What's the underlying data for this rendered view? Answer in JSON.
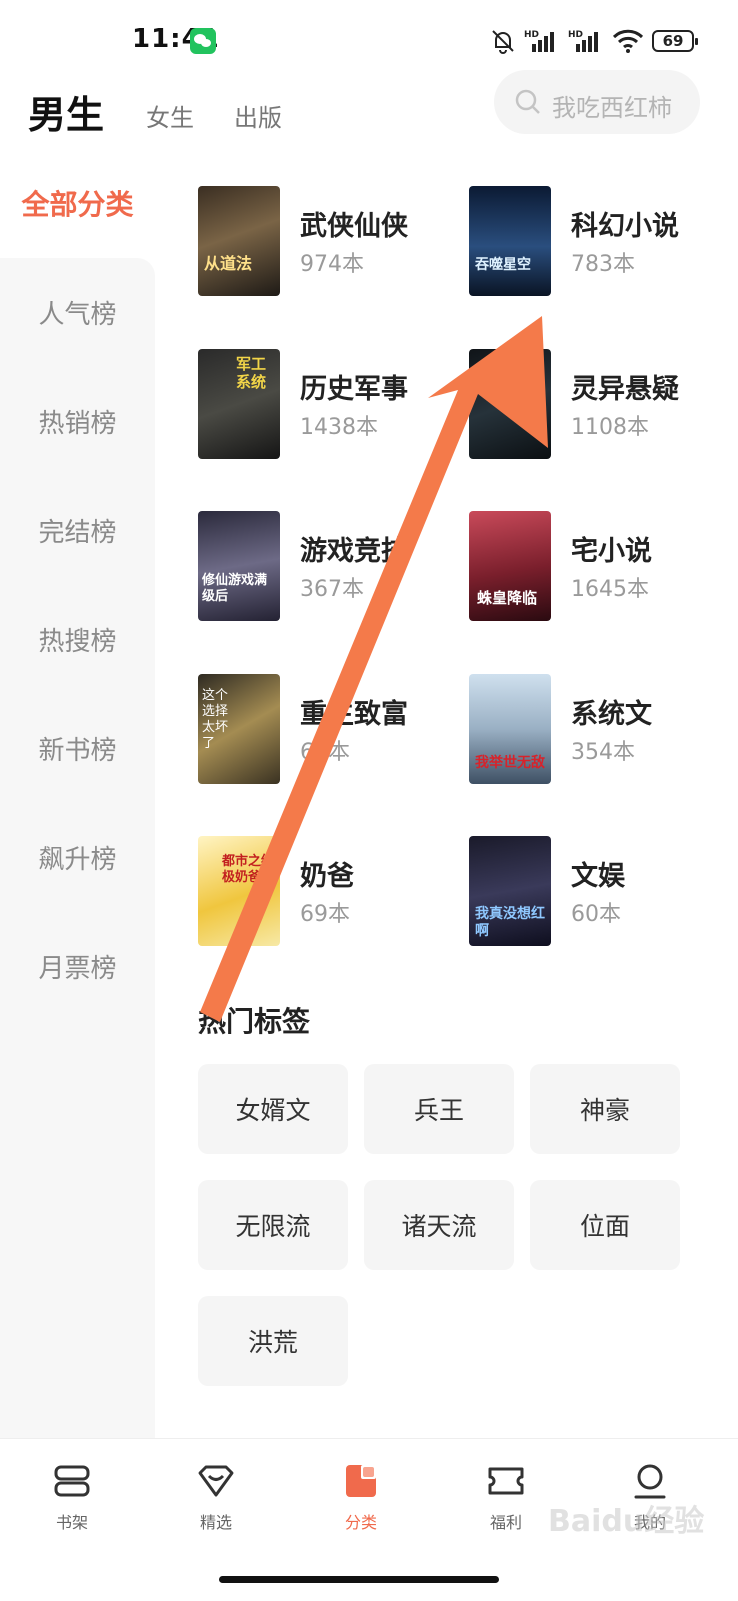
{
  "status_bar": {
    "time": "11:41",
    "battery": "69",
    "signal_tag": "HD"
  },
  "top_nav": {
    "tabs": [
      "男生",
      "女生",
      "出版"
    ],
    "search_placeholder": "我吃西红柿"
  },
  "sidebar": {
    "active": "全部分类",
    "items": [
      "人气榜",
      "热销榜",
      "完结榜",
      "热搜榜",
      "新书榜",
      "飙升榜",
      "月票榜"
    ]
  },
  "categories": [
    {
      "name": "武侠仙侠",
      "count": "974本",
      "cover_text": "从道法"
    },
    {
      "name": "科幻小说",
      "count": "783本",
      "cover_text": "吞噬星空"
    },
    {
      "name": "历史军事",
      "count": "1438本",
      "cover_text": "军工系统"
    },
    {
      "name": "灵异悬疑",
      "count": "1108本",
      "cover_text": ""
    },
    {
      "name": "游戏竞技",
      "count": "367本",
      "cover_text": "修仙游戏满级后"
    },
    {
      "name": "宅小说",
      "count": "1645本",
      "cover_text": "蛛皇降临"
    },
    {
      "name": "重生致富",
      "count": "64本",
      "cover_text": "这个选择太坏了"
    },
    {
      "name": "系统文",
      "count": "354本",
      "cover_text": "我举世无敌"
    },
    {
      "name": "奶爸",
      "count": "69本",
      "cover_text": "都市之终极奶爸"
    },
    {
      "name": "文娱",
      "count": "60本",
      "cover_text": "我真没想红啊"
    }
  ],
  "hot_tags": {
    "title": "热门标签",
    "tags": [
      "女婿文",
      "兵王",
      "神豪",
      "无限流",
      "诸天流",
      "位面",
      "洪荒"
    ]
  },
  "bottom_nav": {
    "items": [
      {
        "label": "书架",
        "icon": "bookshelf-icon"
      },
      {
        "label": "精选",
        "icon": "featured-icon"
      },
      {
        "label": "分类",
        "icon": "category-icon"
      },
      {
        "label": "福利",
        "icon": "ticket-icon"
      },
      {
        "label": "我的",
        "icon": "profile-icon"
      }
    ],
    "active": "分类"
  },
  "watermark": "Baidu经验",
  "colors": {
    "accent": "#f06a4c",
    "arrow": "#f47a4a"
  }
}
